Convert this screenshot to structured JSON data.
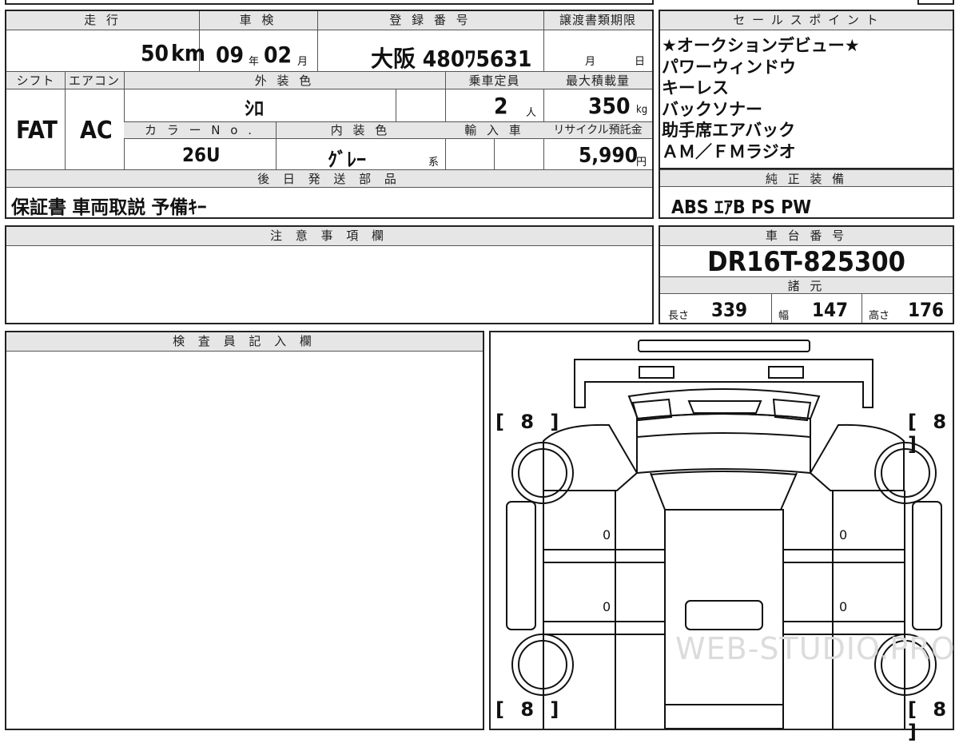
{
  "top_grid": {
    "labels": {
      "mileage": "走 行",
      "inspection": "車 検",
      "registration": "登 録 番 号",
      "transfer_deadline": "譲渡書類期限",
      "shift": "シフト",
      "aircon": "エアコン",
      "exterior_color": "外 装 色",
      "capacity": "乗車定員",
      "max_load": "最大積載量",
      "color_no": "カ ラ ー N o .",
      "interior_color": "内 装 色",
      "import": "輸 入 車",
      "recycle": "リサイクル預託金",
      "later_parts": "後 日 発 送 部 品"
    },
    "values": {
      "mileage": "50",
      "mileage_unit": "km",
      "inspection_year": "09",
      "year_unit": "年",
      "inspection_month": "02",
      "month_unit": "月",
      "registration": "大阪 480ﾜ5631",
      "deadline_month_unit": "月",
      "deadline_day_unit": "日",
      "shift": "FAT",
      "aircon": "AC",
      "exterior_color": "ｼﾛ",
      "capacity": "2",
      "capacity_unit": "人",
      "max_load": "350",
      "max_load_unit": "kg",
      "color_no": "26U",
      "interior_color": "ｸﾞﾚｰ",
      "interior_suffix": "系",
      "recycle": "5,990",
      "recycle_unit": "円",
      "later_parts": "保証書 車両取説 予備ｷｰ"
    }
  },
  "sales_points": {
    "title": "セ ー ル ス ポ イ ン ト",
    "items": [
      "★オークションデビュー★",
      "パワーウィンドウ",
      "キーレス",
      "バックソナー",
      "助手席エアバック",
      "ＡＭ／ＦＭラジオ"
    ]
  },
  "equipment": {
    "title": "純 正 装 備",
    "value": "ABS ｴｱB PS PW"
  },
  "notes": {
    "title": "注 意 事 項 欄",
    "text": ""
  },
  "chassis": {
    "title": "車 台 番 号",
    "value": "DR16T-825300"
  },
  "specs": {
    "title": "諸 元",
    "length_label": "長さ",
    "length": "339",
    "width_label": "幅",
    "width": "147",
    "height_label": "高さ",
    "height": "176"
  },
  "inspector": {
    "title": "検 査 員 記 入 欄",
    "text": ""
  },
  "diagram": {
    "bracket_labels": [
      "[ 8 ]",
      "[ 8 ]",
      "[ 8 ]",
      "[ 8 ]"
    ],
    "panel_marks": [
      "0",
      "0",
      "0",
      "0"
    ],
    "watermark": "WEB-STUDIO.PRO"
  }
}
